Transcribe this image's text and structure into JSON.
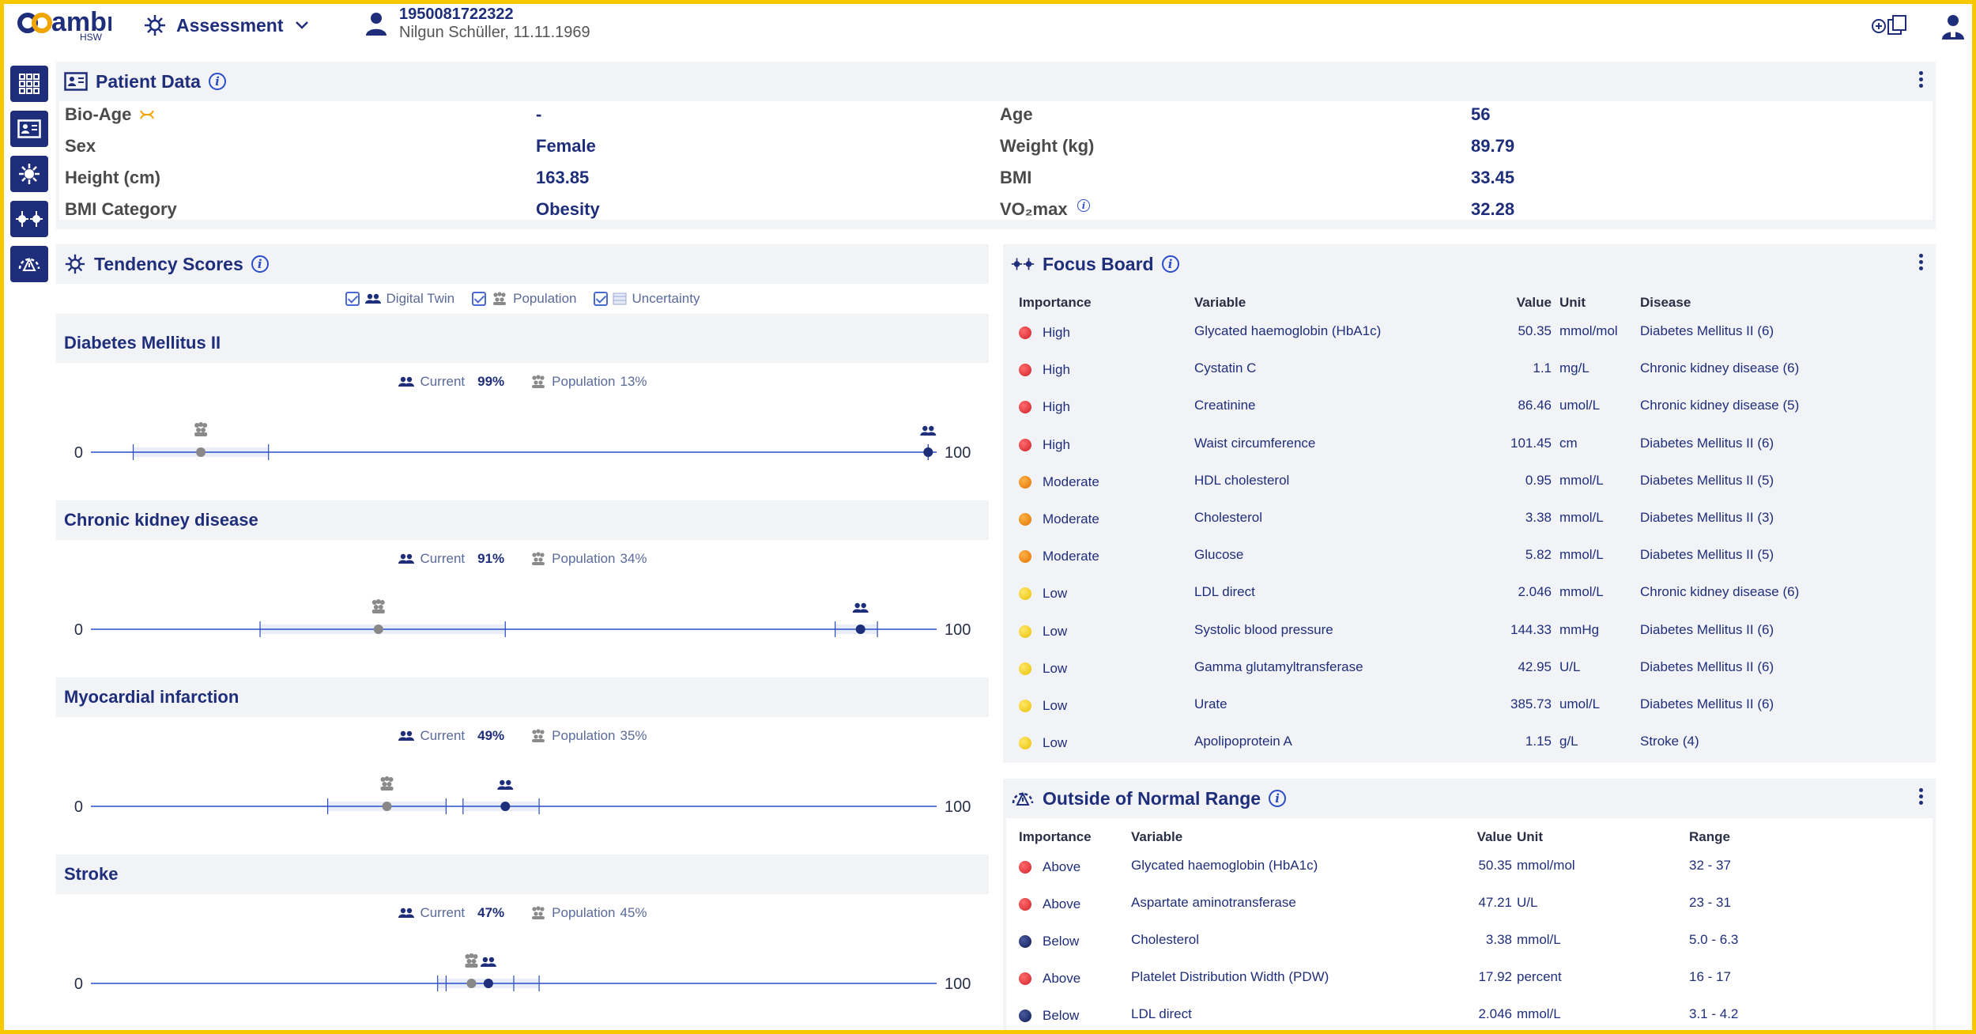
{
  "app": {
    "logo_text": "ambr",
    "logo_sub": "HSW",
    "module_label": "Assessment"
  },
  "patient": {
    "id": "1950081722322",
    "name_line": "Nilgun Schüller, 11.11.1969"
  },
  "sidebar": {
    "items": [
      {
        "icon": "grid-icon"
      },
      {
        "icon": "id-card-icon"
      },
      {
        "icon": "virus-icon"
      },
      {
        "icon": "double-virus-icon"
      },
      {
        "icon": "range-warning-icon"
      }
    ]
  },
  "patient_data": {
    "title": "Patient Data",
    "rows": [
      {
        "label": "Bio-Age",
        "value": "-"
      },
      {
        "label": "Age",
        "value": "56"
      },
      {
        "label": "Sex",
        "value": "Female"
      },
      {
        "label": "Weight (kg)",
        "value": "89.79"
      },
      {
        "label": "Height (cm)",
        "value": "163.85"
      },
      {
        "label": "BMI",
        "value": "33.45"
      },
      {
        "label": "BMI Category",
        "value": "Obesity"
      },
      {
        "label": "VO₂max",
        "value": "32.28"
      }
    ]
  },
  "tendency": {
    "title": "Tendency Scores",
    "legend": {
      "digital_twin": "Digital Twin",
      "population": "Population",
      "uncertainty": "Uncertainty"
    },
    "axis_min": "0",
    "axis_max": "100",
    "current_label": "Current",
    "population_label": "Population",
    "diseases": [
      {
        "name": "Diabetes Mellitus II",
        "current": 99,
        "current_text": "99%",
        "population": 13,
        "population_text": "13%",
        "cur_lo": 99,
        "cur_hi": 99,
        "pop_lo": 5,
        "pop_hi": 21
      },
      {
        "name": "Chronic kidney disease",
        "current": 91,
        "current_text": "91%",
        "population": 34,
        "population_text": "34%",
        "cur_lo": 88,
        "cur_hi": 93,
        "pop_lo": 20,
        "pop_hi": 49
      },
      {
        "name": "Myocardial infarction",
        "current": 49,
        "current_text": "49%",
        "population": 35,
        "population_text": "35%",
        "cur_lo": 44,
        "cur_hi": 53,
        "pop_lo": 28,
        "pop_hi": 42
      },
      {
        "name": "Stroke",
        "current": 47,
        "current_text": "47%",
        "population": 45,
        "population_text": "45%",
        "cur_lo": 42,
        "cur_hi": 53,
        "pop_lo": 41,
        "pop_hi": 50
      }
    ]
  },
  "focus": {
    "title": "Focus Board",
    "headers": {
      "importance": "Importance",
      "variable": "Variable",
      "value": "Value",
      "unit": "Unit",
      "disease": "Disease"
    },
    "rows": [
      {
        "level": "high",
        "importance": "High",
        "variable": "Glycated haemoglobin (HbA1c)",
        "value": "50.35",
        "unit": "mmol/mol",
        "disease": "Diabetes Mellitus II (6)"
      },
      {
        "level": "high",
        "importance": "High",
        "variable": "Cystatin C",
        "value": "1.1",
        "unit": "mg/L",
        "disease": "Chronic kidney disease (6)"
      },
      {
        "level": "high",
        "importance": "High",
        "variable": "Creatinine",
        "value": "86.46",
        "unit": "umol/L",
        "disease": "Chronic kidney disease (5)"
      },
      {
        "level": "high",
        "importance": "High",
        "variable": "Waist circumference",
        "value": "101.45",
        "unit": "cm",
        "disease": "Diabetes Mellitus II (6)"
      },
      {
        "level": "mod",
        "importance": "Moderate",
        "variable": "HDL cholesterol",
        "value": "0.95",
        "unit": "mmol/L",
        "disease": "Diabetes Mellitus II (5)"
      },
      {
        "level": "mod",
        "importance": "Moderate",
        "variable": "Cholesterol",
        "value": "3.38",
        "unit": "mmol/L",
        "disease": "Diabetes Mellitus II (3)"
      },
      {
        "level": "mod",
        "importance": "Moderate",
        "variable": "Glucose",
        "value": "5.82",
        "unit": "mmol/L",
        "disease": "Diabetes Mellitus II (5)"
      },
      {
        "level": "low",
        "importance": "Low",
        "variable": "LDL direct",
        "value": "2.046",
        "unit": "mmol/L",
        "disease": "Chronic kidney disease (6)"
      },
      {
        "level": "low",
        "importance": "Low",
        "variable": "Systolic blood pressure",
        "value": "144.33",
        "unit": "mmHg",
        "disease": "Diabetes Mellitus II (6)"
      },
      {
        "level": "low",
        "importance": "Low",
        "variable": "Gamma glutamyltransferase",
        "value": "42.95",
        "unit": "U/L",
        "disease": "Diabetes Mellitus II (6)"
      },
      {
        "level": "low",
        "importance": "Low",
        "variable": "Urate",
        "value": "385.73",
        "unit": "umol/L",
        "disease": "Diabetes Mellitus II (6)"
      },
      {
        "level": "low",
        "importance": "Low",
        "variable": "Apolipoprotein A",
        "value": "1.15",
        "unit": "g/L",
        "disease": "Stroke (4)"
      }
    ]
  },
  "outside": {
    "title": "Outside of Normal Range",
    "headers": {
      "importance": "Importance",
      "variable": "Variable",
      "value": "Value",
      "unit": "Unit",
      "range": "Range"
    },
    "rows": [
      {
        "level": "high",
        "importance": "Above",
        "variable": "Glycated haemoglobin (HbA1c)",
        "value": "50.35",
        "unit": "mmol/mol",
        "range": "32 - 37"
      },
      {
        "level": "high",
        "importance": "Above",
        "variable": "Aspartate aminotransferase",
        "value": "47.21",
        "unit": "U/L",
        "range": "23 - 31"
      },
      {
        "level": "below",
        "importance": "Below",
        "variable": "Cholesterol",
        "value": "3.38",
        "unit": "mmol/L",
        "range": "5.0 - 6.3"
      },
      {
        "level": "high",
        "importance": "Above",
        "variable": "Platelet Distribution Width (PDW)",
        "value": "17.92",
        "unit": "percent",
        "range": "16 - 17"
      },
      {
        "level": "below",
        "importance": "Below",
        "variable": "LDL direct",
        "value": "2.046",
        "unit": "mmol/L",
        "range": "3.1 - 4.2"
      }
    ]
  },
  "colors": {
    "brand": "#1f2e7a",
    "accent": "#f0a400",
    "panel_bg": "#f2f3f7",
    "frame": "#f7c800"
  }
}
